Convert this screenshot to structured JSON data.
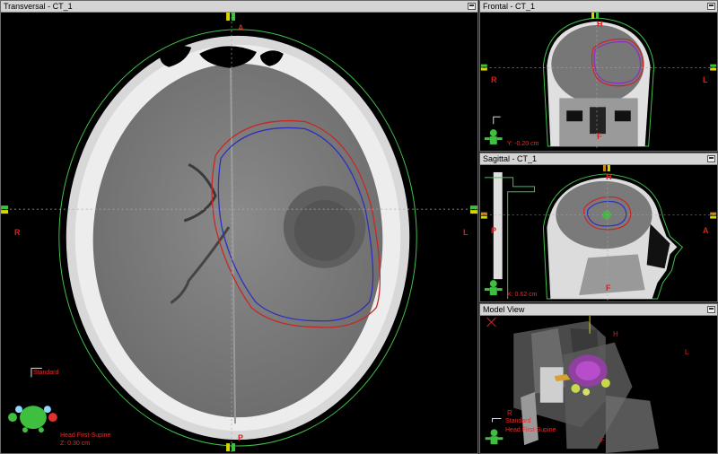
{
  "transversal": {
    "title": "Transversal - CT_1",
    "orient": {
      "top": "A",
      "bottom": "P",
      "left": "R",
      "right": "L"
    },
    "info": {
      "standard": "Standard",
      "position": "Head First-Supine",
      "coord": "Z: 0.30 cm"
    }
  },
  "frontal": {
    "title": "Frontal - CT_1",
    "orient": {
      "top": "H",
      "bottom": "F",
      "left": "R",
      "right": "L"
    },
    "info": {
      "coord": "Y: -0.20 cm"
    }
  },
  "sagittal": {
    "title": "Sagittal - CT_1",
    "orient": {
      "top": "H",
      "bottom": "F",
      "left": "P",
      "right": "A"
    },
    "info": {
      "coord": "X: 0.62 cm"
    }
  },
  "model": {
    "title": "Model View",
    "orient": {
      "h": "H",
      "l": "L",
      "r": "R",
      "f": "F"
    },
    "info": {
      "standard": "Standard",
      "position": "Head First-Supine"
    }
  },
  "colors": {
    "contour_red": "#c62828",
    "contour_blue": "#2f2fbf",
    "body_green": "#41c04a",
    "marker_yellow": "#d7d400"
  }
}
